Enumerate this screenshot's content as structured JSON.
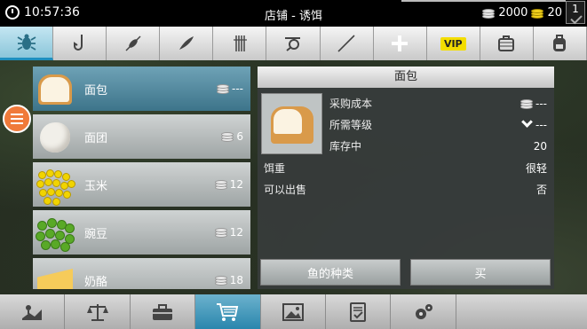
{
  "status": {
    "time": "10:57:36",
    "title": "店铺 - 诱饵",
    "silver": "2000",
    "gold": "20",
    "level": "1"
  },
  "categories": [
    {
      "icon": "bug-icon",
      "active": true
    },
    {
      "icon": "hook-icon"
    },
    {
      "icon": "float-icon"
    },
    {
      "icon": "lure-icon"
    },
    {
      "icon": "line-icon"
    },
    {
      "icon": "reel-icon"
    },
    {
      "icon": "rod-icon"
    },
    {
      "icon": "plus-icon"
    },
    {
      "icon": "vip-icon",
      "label": "VIP"
    },
    {
      "icon": "bag-icon"
    },
    {
      "icon": "backpack-icon"
    }
  ],
  "items": [
    {
      "name": "面包",
      "price": "---"
    },
    {
      "name": "面团",
      "price": "6"
    },
    {
      "name": "玉米",
      "price": "12"
    },
    {
      "name": "豌豆",
      "price": "12"
    },
    {
      "name": "奶酪",
      "price": "18"
    }
  ],
  "detail": {
    "title": "面包",
    "cost_label": "采购成本",
    "cost_value": "---",
    "level_label": "所需等级",
    "level_value": "---",
    "stock_label": "库存中",
    "stock_value": "20",
    "weight_label": "饵重",
    "weight_value": "很轻",
    "sellable_label": "可以出售",
    "sellable_value": "否",
    "fish_button": "鱼的种类",
    "buy_button": "买"
  },
  "bottom_tabs": [
    "map-icon",
    "scales-icon",
    "toolbox-icon",
    "cart-icon",
    "picture-icon",
    "checklist-icon",
    "gears-icon"
  ],
  "colors": {
    "accent": "#1e8fbf",
    "menu": "#f07a3a",
    "gold": "#f2d21d"
  }
}
